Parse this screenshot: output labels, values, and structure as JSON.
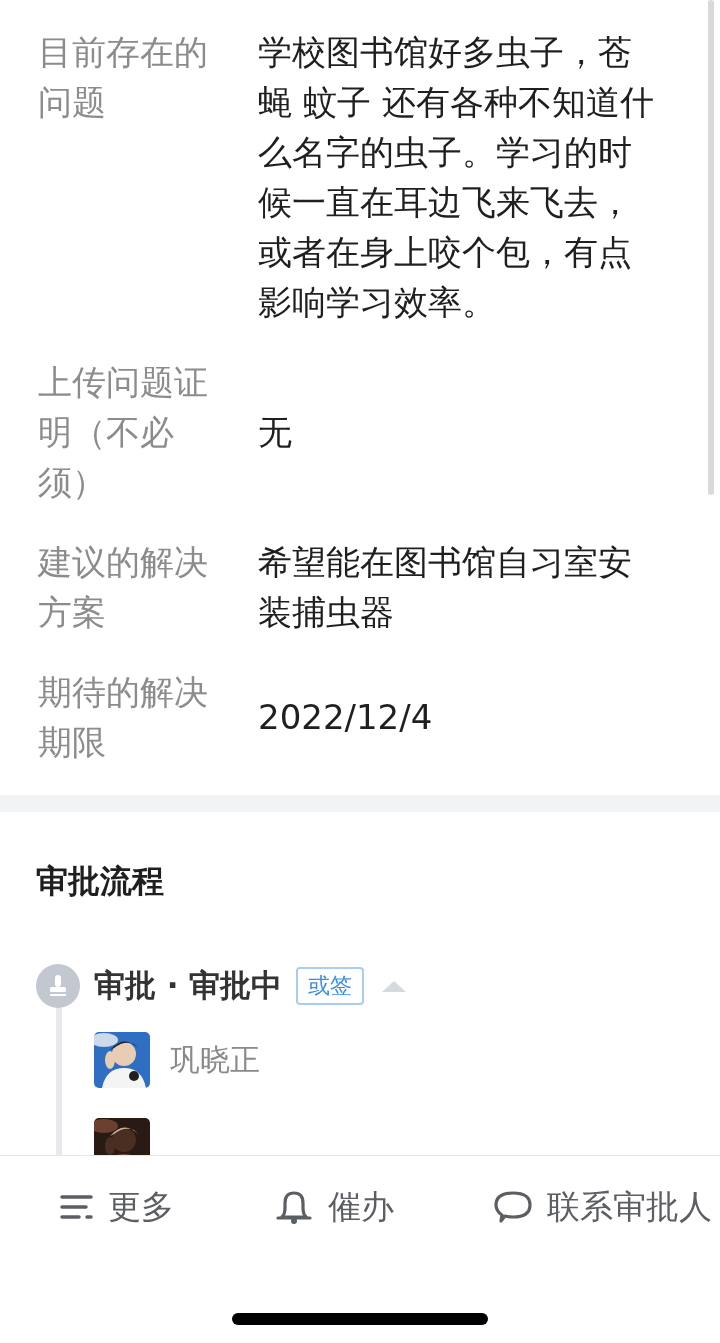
{
  "form_fields": [
    {
      "label": "目前存在的问题",
      "value": "学校图书馆好多虫子，苍蝇 蚊子 还有各种不知道什么名字的虫子。学习的时候一直在耳边飞来飞去，或者在身上咬个包，有点影响学习效率。"
    },
    {
      "label": "上传问题证明（不必须）",
      "value": "无"
    },
    {
      "label": "建议的解决方案",
      "value": "希望能在图书馆自习室安装捕虫器"
    },
    {
      "label": "期待的解决期限",
      "value": "2022/12/4"
    }
  ],
  "approval_flow": {
    "title": "审批流程",
    "step": {
      "title": "审批 · 审批中",
      "tag": "或签",
      "expanded": true
    },
    "approvers": [
      {
        "name": "巩晓正",
        "avatar": {
          "kind": "picture"
        }
      },
      {
        "avatar": {
          "kind": "picture"
        }
      }
    ]
  },
  "bottom_bar": [
    {
      "kind": "more",
      "label": "更多"
    },
    {
      "kind": "remind",
      "label": "催办"
    },
    {
      "kind": "contact",
      "label": "联系审批人"
    }
  ]
}
